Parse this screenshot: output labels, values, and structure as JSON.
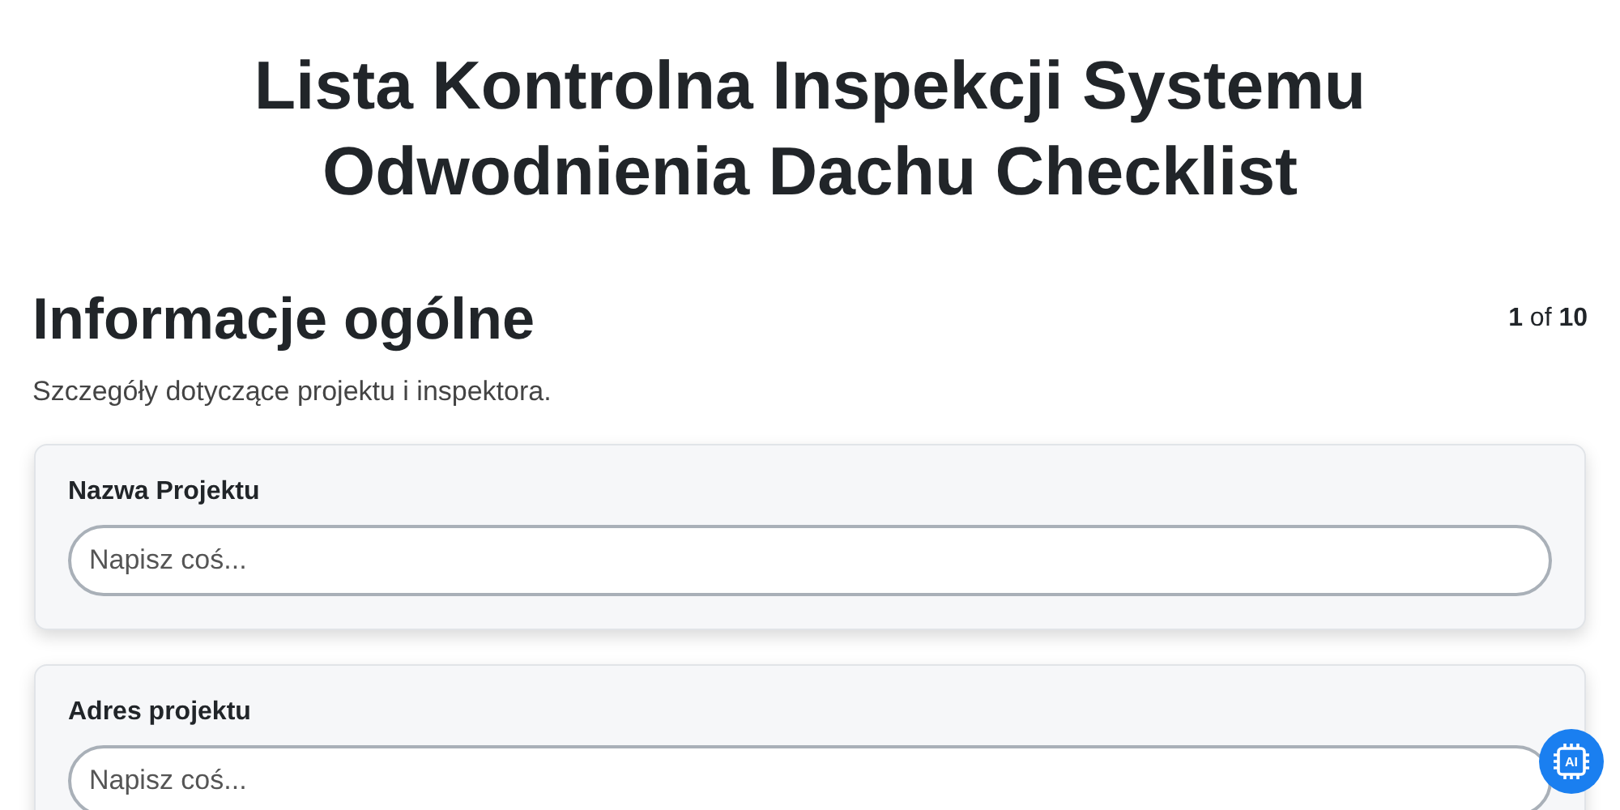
{
  "title": "Lista Kontrolna Inspekcji Systemu Odwodnienia Dachu Checklist",
  "section": {
    "heading": "Informacje ogólne",
    "counter": "**1** of **10**",
    "description": "Szczegóły dotyczące projektu i inspektora."
  },
  "fields": [
    {
      "label": "Nazwa Projektu",
      "placeholder": "Napisz coś..."
    },
    {
      "label": "Adres projektu",
      "placeholder": "Napisz coś..."
    }
  ],
  "ai_badge": {
    "label": "AI"
  }
}
